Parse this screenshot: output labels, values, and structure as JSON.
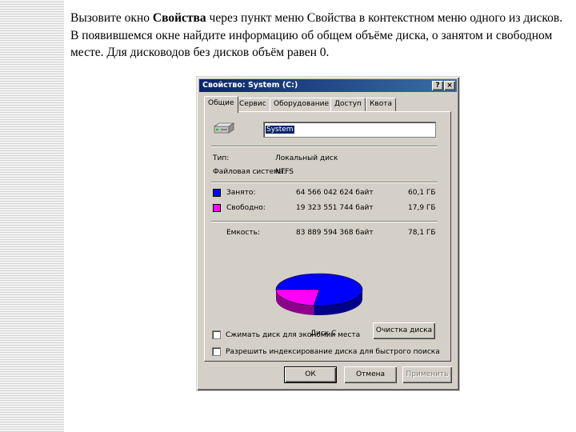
{
  "instruction": {
    "part1": "Вызовите окно ",
    "bold": "Свойства",
    "part2": " через пункт меню Свойства в контекстном меню одного из дисков. В появившемся окне найдите информацию об общем объёме диска, о занятом и свободном месте. Для дисководов без дисков объём равен 0."
  },
  "dialog": {
    "title": "Свойство: System (C:)",
    "help_label": "?",
    "close_label": "×",
    "tabs": [
      {
        "label": "Общие",
        "active": true
      },
      {
        "label": "Сервис"
      },
      {
        "label": "Оборудование"
      },
      {
        "label": "Доступ"
      },
      {
        "label": "Квота"
      }
    ],
    "name_value": "System",
    "type_label": "Тип:",
    "type_value": "Локальный диск",
    "fs_label": "Файловая система:",
    "fs_value": "NTFS",
    "used": {
      "label": "Занято:",
      "bytes": "64 566 042 624 байт",
      "size": "60,1 ГБ",
      "color": "#0000ff"
    },
    "free": {
      "label": "Свободно:",
      "bytes": "19 323 551 744 байт",
      "size": "17,9 ГБ",
      "color": "#ff00ff"
    },
    "capacity": {
      "label": "Емкость:",
      "bytes": "83 889 594 368 байт",
      "size": "78,1 ГБ"
    },
    "used_fraction": 0.77,
    "disk_label": "Диск C",
    "cleanup_button": "Очистка диска",
    "compress_label": "Сжимать диск для экономии места",
    "index_label": "Разрешить индексирование диска для быстрого поиска",
    "ok_button": "ОК",
    "cancel_button": "Отмена",
    "apply_button": "Применить"
  }
}
